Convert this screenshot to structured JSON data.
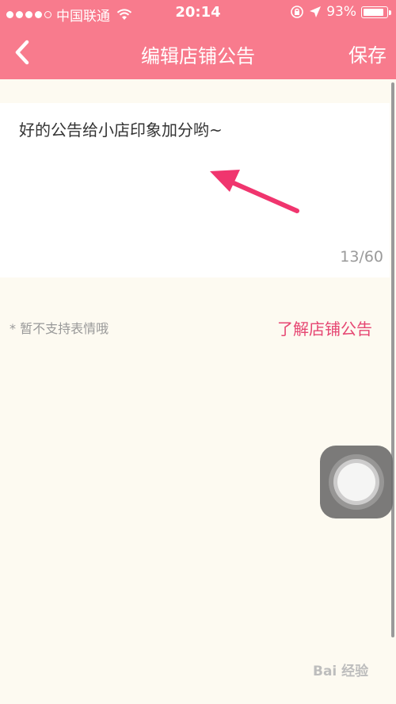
{
  "status_bar": {
    "carrier": "中国联通",
    "time": "20:14",
    "battery": "93%",
    "battery_level": 0.93
  },
  "nav": {
    "back_icon": "chevron-left-icon",
    "title": "编辑店铺公告",
    "save_label": "保存"
  },
  "editor": {
    "text": "好的公告给小店印象加分哟~",
    "char_count": "13/60"
  },
  "hint": "* 暂不支持表情哦",
  "learn_link": "了解店铺公告",
  "watermark": "Bai 经验",
  "colors": {
    "header": "#f87b8d",
    "link": "#e64672",
    "arrow": "#f0356e"
  }
}
